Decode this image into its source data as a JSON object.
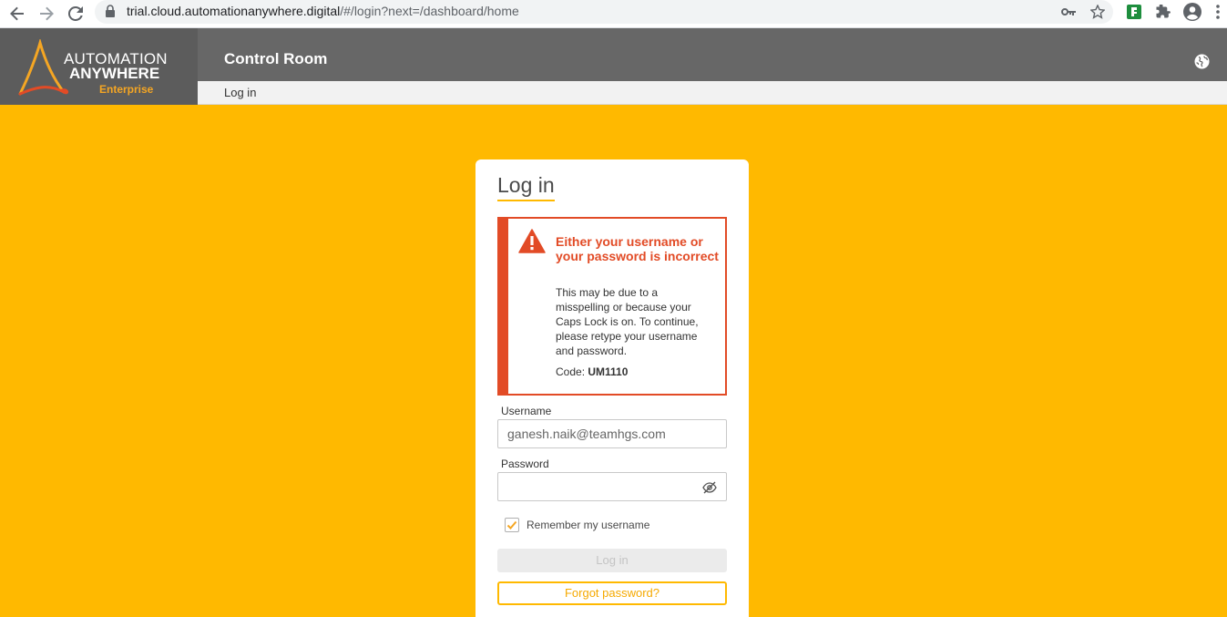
{
  "browser": {
    "url_host": "trial.cloud.automationanywhere.digital",
    "url_path": "/#/login?next=/dashboard/home",
    "icons": [
      "back-arrow-icon",
      "forward-arrow-icon",
      "reload-icon",
      "lock-icon",
      "key-icon",
      "star-icon",
      "extension-icon",
      "puzzle-icon",
      "profile-icon",
      "more-menu-icon"
    ]
  },
  "logo": {
    "line1": "AUTOMATION",
    "line2": "ANYWHERE",
    "line3": "Enterprise"
  },
  "header": {
    "title": "Control Room",
    "subnav_link": "Log in"
  },
  "login": {
    "title": "Log in",
    "error": {
      "title": "Either your username or your password is incorrect",
      "message": "This may be due to a misspelling or because your Caps Lock is on. To continue, please retype your username and password.",
      "code_label": "Code: ",
      "code_value": "UM1110"
    },
    "username_label": "Username",
    "username_value": "ganesh.naik@teamhgs.com",
    "password_label": "Password",
    "password_value": "",
    "remember_label": "Remember my username",
    "remember_checked": true,
    "login_button": "Log in",
    "forgot_button": "Forgot password?"
  },
  "colors": {
    "background": "#ffb900",
    "header_dark": "#676767",
    "logo_bg": "#5c5c5c",
    "error": "#e24b26",
    "accent": "#f5a623"
  }
}
